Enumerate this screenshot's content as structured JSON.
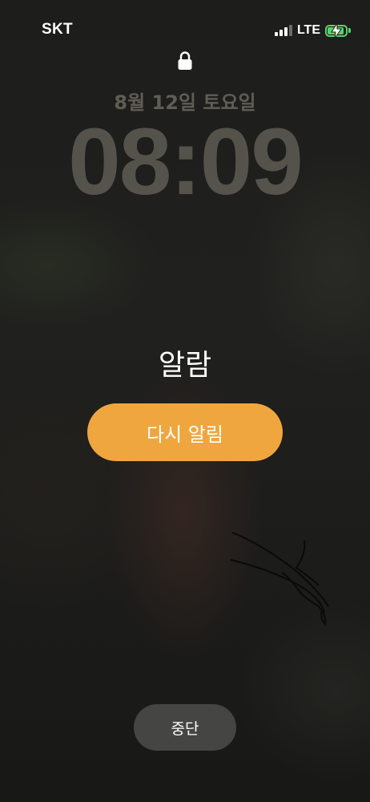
{
  "status_bar": {
    "carrier": "SKT",
    "network": "LTE",
    "signal_bars_active": 3,
    "signal_bars_total": 4,
    "battery_icon": "battery-charging-icon",
    "battery_level": 0.9,
    "battery_color": "#5ad16a"
  },
  "lock_screen": {
    "lock_icon": "lock-icon",
    "date": "8월 12일 토요일",
    "time": "08:09"
  },
  "alarm": {
    "title": "알람",
    "snooze_label": "다시 알림",
    "stop_label": "중단",
    "accent_color": "#f0a63e"
  }
}
